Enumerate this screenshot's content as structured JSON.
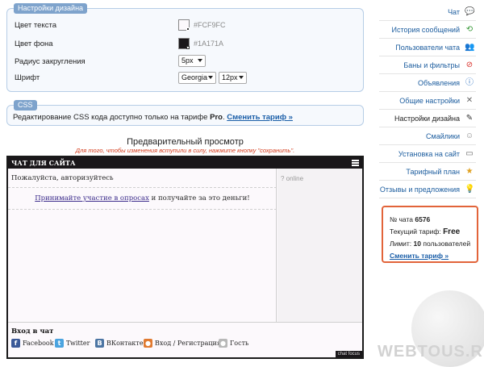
{
  "design": {
    "legend": "Настройки дизайна",
    "text_color_label": "Цвет текста",
    "text_color_value": "#FCF9FC",
    "bg_color_label": "Цвет фона",
    "bg_color_value": "#1A171A",
    "radius_label": "Радиус закругления",
    "radius_value": "5px",
    "font_label": "Шрифт",
    "font_value": "Georgia",
    "font_size_value": "12px"
  },
  "css": {
    "legend": "CSS",
    "text_before": "Редактирование CSS кода доступно только на тарифе ",
    "plan": "Pro",
    "text_after": ". ",
    "link": "Сменить тариф »"
  },
  "preview": {
    "title": "Предварительный просмотр",
    "note": "Для того, чтобы изменения вступили в силу, нажмите кнопку \"сохранить\"."
  },
  "chat": {
    "header": "ЧАТ ДЛЯ САЙТА",
    "greeting": "Пожалуйста, авторизуйтесь",
    "promo_link": "Принимайте участие в опросах",
    "promo_rest": " и получайте за это деньги!",
    "online": "? online",
    "login_title": "Вход в чат",
    "login_options": [
      "Facebook",
      "Twitter",
      "ВКонтакте",
      "Вход / Регистрация",
      "Гость"
    ],
    "branding": "chat focus"
  },
  "sidebar": {
    "items": [
      {
        "label": "Чат",
        "icon": "speech-bubble-icon"
      },
      {
        "label": "История сообщений",
        "icon": "history-icon"
      },
      {
        "label": "Пользователи чата",
        "icon": "users-icon"
      },
      {
        "label": "Баны и фильтры",
        "icon": "ban-icon"
      },
      {
        "label": "Объявления",
        "icon": "info-icon"
      },
      {
        "label": "Общие настройки",
        "icon": "tools-icon"
      },
      {
        "label": "Настройки дизайна",
        "icon": "brush-icon"
      },
      {
        "label": "Смайлики",
        "icon": "smiley-icon"
      },
      {
        "label": "Установка на сайт",
        "icon": "monitor-icon"
      },
      {
        "label": "Тарифный план",
        "icon": "star-icon"
      },
      {
        "label": "Отзывы и предложения",
        "icon": "lightbulb-icon"
      }
    ],
    "active_index": 6
  },
  "info": {
    "chat_no_label": "№ чата ",
    "chat_no": "6576",
    "plan_label": "Текущий тариф: ",
    "plan": "Free",
    "limit_label": "Лимит: ",
    "limit": "10",
    "limit_unit": " пользователей",
    "link": "Сменить тариф »"
  },
  "watermark": "WEBTOUS.RU",
  "colors": {
    "accent": "#1a5ea8",
    "chat_bg": "#1A171A",
    "chat_text": "#FCF9FC",
    "info_border": "#e2643a",
    "note": "#d43a1a"
  }
}
